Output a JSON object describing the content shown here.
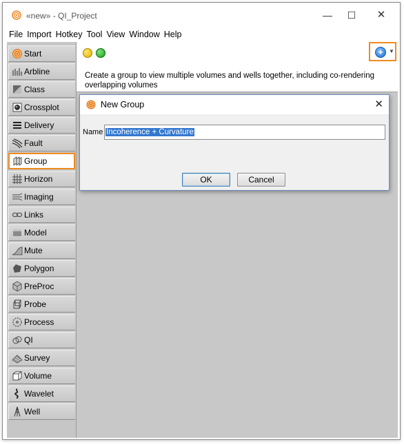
{
  "window": {
    "title": "«new» - QI_Project",
    "minimize_glyph": "—",
    "maximize_glyph": "☐",
    "close_glyph": "✕"
  },
  "menu": [
    "File",
    "Import",
    "Hotkey",
    "Tool",
    "View",
    "Window",
    "Help"
  ],
  "sidebar": {
    "items": [
      {
        "label": "Start",
        "icon": "start-icon"
      },
      {
        "label": "Arbline",
        "icon": "arbline-icon"
      },
      {
        "label": "Class",
        "icon": "class-icon"
      },
      {
        "label": "Crossplot",
        "icon": "crossplot-icon"
      },
      {
        "label": "Delivery",
        "icon": "delivery-icon"
      },
      {
        "label": "Fault",
        "icon": "fault-icon"
      },
      {
        "label": "Group",
        "icon": "group-icon",
        "active": true
      },
      {
        "label": "Horizon",
        "icon": "horizon-icon"
      },
      {
        "label": "Imaging",
        "icon": "imaging-icon"
      },
      {
        "label": "Links",
        "icon": "links-icon"
      },
      {
        "label": "Model",
        "icon": "model-icon"
      },
      {
        "label": "Mute",
        "icon": "mute-icon"
      },
      {
        "label": "Polygon",
        "icon": "polygon-icon"
      },
      {
        "label": "PreProc",
        "icon": "preproc-icon"
      },
      {
        "label": "Probe",
        "icon": "probe-icon"
      },
      {
        "label": "Process",
        "icon": "process-icon"
      },
      {
        "label": "QI",
        "icon": "qi-icon"
      },
      {
        "label": "Survey",
        "icon": "survey-icon"
      },
      {
        "label": "Volume",
        "icon": "volume-icon"
      },
      {
        "label": "Wavelet",
        "icon": "wavelet-icon"
      },
      {
        "label": "Well",
        "icon": "well-icon"
      }
    ]
  },
  "main": {
    "description": "Create a group to view multiple volumes and wells together, including co-rendering overlapping volumes",
    "add_button_glyph": "+",
    "add_dropdown_glyph": "▼"
  },
  "dialog": {
    "title": "New Group",
    "close_glyph": "✕",
    "name_label": "Name",
    "name_value": "Incoherence + Curvature",
    "ok_label": "OK",
    "cancel_label": "Cancel"
  },
  "colors": {
    "highlight": "#f08a1c",
    "selection": "#3378d0",
    "panel": "#c8c8c8"
  }
}
